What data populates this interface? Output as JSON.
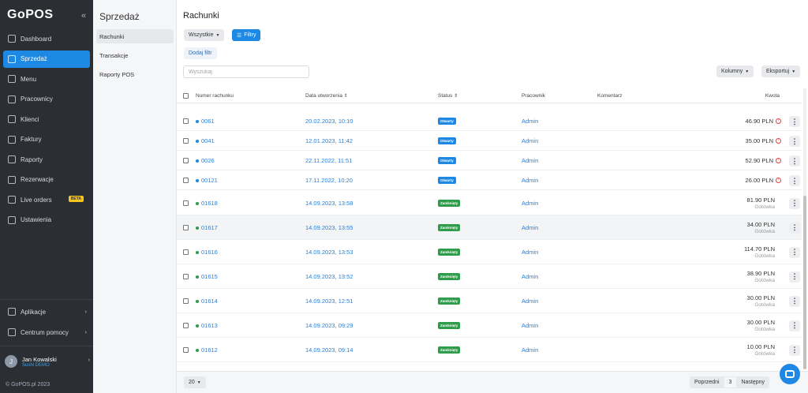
{
  "sidebar": {
    "logo": "GoPOS",
    "collapse": "«",
    "items": [
      {
        "label": "Dashboard",
        "icon": "dashboard-icon"
      },
      {
        "label": "Sprzedaż",
        "icon": "cart-icon",
        "active": true
      },
      {
        "label": "Menu",
        "icon": "menu-book-icon"
      },
      {
        "label": "Pracownicy",
        "icon": "employees-icon"
      },
      {
        "label": "Klienci",
        "icon": "clients-icon"
      },
      {
        "label": "Faktury",
        "icon": "invoice-icon"
      },
      {
        "label": "Raporty",
        "icon": "reports-icon"
      },
      {
        "label": "Rezerwacje",
        "icon": "reservation-icon"
      },
      {
        "label": "Live orders",
        "icon": "live-orders-icon",
        "badge": "BETA"
      },
      {
        "label": "Ustawienia",
        "icon": "settings-icon"
      }
    ],
    "bottom": [
      {
        "label": "Aplikacje",
        "icon": "apps-icon",
        "arrow": "›"
      },
      {
        "label": "Centrum pomocy",
        "icon": "help-icon",
        "arrow": "›"
      }
    ],
    "user": {
      "initial": "J",
      "name": "Jan Kowalski",
      "sub": "Sushi DEMO",
      "arrow": "›"
    },
    "copyright": "© GoPOS.pl 2023"
  },
  "submenu": {
    "title": "Sprzedaż",
    "items": [
      "Rachunki",
      "Transakcje",
      "Raporty POS"
    ]
  },
  "main": {
    "title": "Rachunki",
    "filter_select": "Wszystkie",
    "filters_btn": "Filtry",
    "add_filter": "Dodaj filtr",
    "search_placeholder": "Wyszukaj",
    "columns_btn": "Kolumny",
    "export_btn": "Eksportuj",
    "columns": {
      "number": "Numer rachunku",
      "date": "Data utworzenia",
      "status": "Status",
      "employee": "Pracownik",
      "comment": "Komentarz",
      "amount": "Kwota"
    },
    "rows": [
      {
        "number": "0061",
        "date": "20.02.2023, 10:10",
        "status": "Otwarty",
        "employee": "Admin",
        "amount": "46.90 PLN",
        "method": "",
        "warn": true,
        "dot": "#1e88e5"
      },
      {
        "number": "0041",
        "date": "12.01.2023, 11:42",
        "status": "Otwarty",
        "employee": "Admin",
        "amount": "35.00 PLN",
        "method": "",
        "warn": true,
        "dot": "#1e88e5"
      },
      {
        "number": "0026",
        "date": "22.11.2022, 11:51",
        "status": "Otwarty",
        "employee": "Admin",
        "amount": "52.90 PLN",
        "method": "",
        "warn": true,
        "dot": "#1e88e5"
      },
      {
        "number": "00121",
        "date": "17.11.2022, 10:20",
        "status": "Otwarty",
        "employee": "Admin",
        "amount": "26.00 PLN",
        "method": "",
        "warn": true,
        "dot": "#1e88e5"
      },
      {
        "number": "01618",
        "date": "14.09.2023, 13:58",
        "status": "Zamknięty",
        "employee": "Admin",
        "amount": "81.90 PLN",
        "method": "Gotówka",
        "warn": false,
        "dot": "#2e9c4a"
      },
      {
        "number": "01617",
        "date": "14.09.2023, 13:55",
        "status": "Zamknięty",
        "employee": "Admin",
        "amount": "34.00 PLN",
        "method": "Gotówka",
        "warn": false,
        "dot": "#2e9c4a"
      },
      {
        "number": "01616",
        "date": "14.09.2023, 13:53",
        "status": "Zamknięty",
        "employee": "Admin",
        "amount": "114.70 PLN",
        "method": "Gotówka",
        "warn": false,
        "dot": "#2e9c4a"
      },
      {
        "number": "01615",
        "date": "14.09.2023, 13:52",
        "status": "Zamknięty",
        "employee": "Admin",
        "amount": "38.90 PLN",
        "method": "Gotówka",
        "warn": false,
        "dot": "#2e9c4a"
      },
      {
        "number": "01614",
        "date": "14.09.2023, 12:51",
        "status": "Zamknięty",
        "employee": "Admin",
        "amount": "30.00 PLN",
        "method": "Gotówka",
        "warn": false,
        "dot": "#2e9c4a"
      },
      {
        "number": "01613",
        "date": "14.09.2023, 09:29",
        "status": "Zamknięty",
        "employee": "Admin",
        "amount": "30.00 PLN",
        "method": "Gotówka",
        "warn": false,
        "dot": "#2e9c4a"
      },
      {
        "number": "01612",
        "date": "14.09.2023, 09:14",
        "status": "Zamknięty",
        "employee": "Admin",
        "amount": "10.00 PLN",
        "method": "Gotówka",
        "warn": false,
        "dot": "#2e9c4a"
      }
    ],
    "per_page": "20",
    "pager": {
      "prev": "Poprzedni",
      "page": "3",
      "next": "Następny"
    }
  },
  "colors": {
    "accent": "#1e88e5",
    "sidebar_bg": "#2b2f33",
    "open": "#1e88e5",
    "closed": "#2e9c4a",
    "warn": "#e04040"
  }
}
